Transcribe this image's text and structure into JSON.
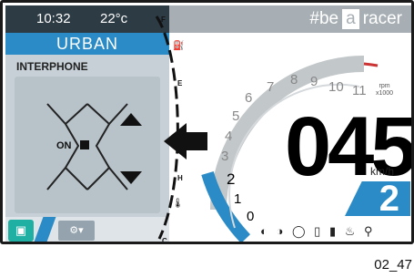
{
  "status": {
    "time": "10:32",
    "temp": "22°c"
  },
  "mode": {
    "label": "URBAN"
  },
  "menu": {
    "title": "INTERPHONE",
    "on_label": "ON"
  },
  "brand": {
    "prefix": "#be",
    "box": "a",
    "suffix": "racer"
  },
  "speed": {
    "value": "045",
    "unit": "km/h"
  },
  "gear": {
    "value": "2"
  },
  "rpm": {
    "label_top": "rpm",
    "label_bottom": "x1000",
    "ticks": [
      "0",
      "1",
      "2",
      "3",
      "4",
      "5",
      "6",
      "7",
      "8",
      "9",
      "10",
      "11"
    ]
  },
  "fuel": {
    "labels": [
      "F",
      "E",
      "H",
      "C"
    ]
  },
  "indicators": [
    "headlight-icon",
    "low-beam-icon",
    "tyre-pressure-icon",
    "phone-icon",
    "battery-icon",
    "oil-icon",
    "location-icon"
  ],
  "caption": "02_47",
  "colors": {
    "accent": "#2a8bc6",
    "panel": "#c7d0d6",
    "header": "#2d3b44",
    "chat": "#1fb0a3",
    "redline": "#cc3333"
  }
}
